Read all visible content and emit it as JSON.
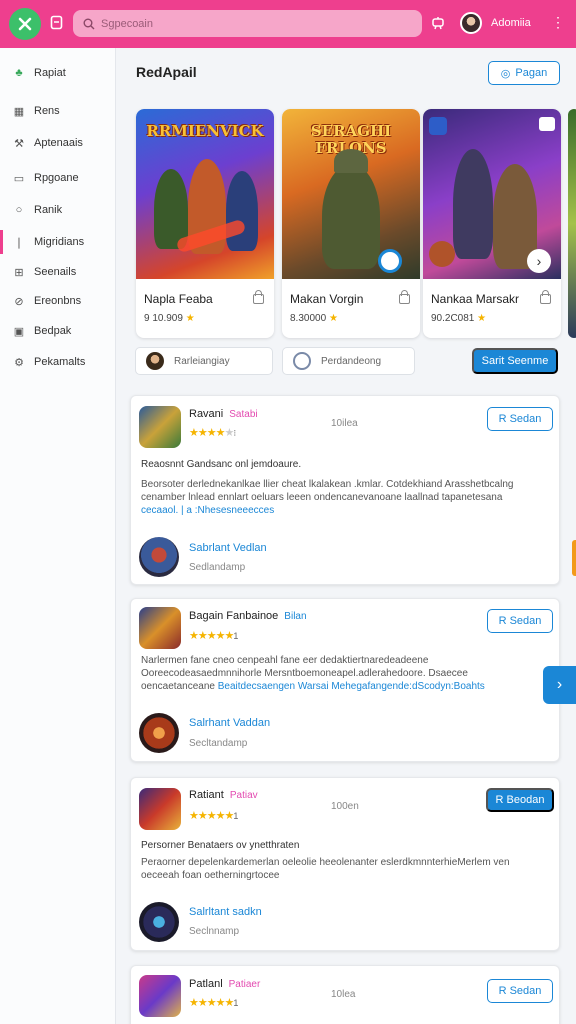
{
  "topbar": {
    "search_placeholder": "Sgpecoain",
    "username": "Adomiia",
    "icons": [
      "app-logo-icon",
      "bookmark-icon",
      "search-icon",
      "controller-icon",
      "kebab-menu-icon"
    ]
  },
  "colors": {
    "brand": "#ee3f8e",
    "accent": "#1b87d6",
    "logo": "#3cc06a",
    "star": "#f5b400"
  },
  "sidebar": {
    "items": [
      {
        "label": "Rapiat",
        "icon": "home-icon"
      },
      {
        "label": "Rens",
        "icon": "calendar-icon"
      },
      {
        "label": "Aptenaais",
        "icon": "wrench-icon"
      },
      {
        "label": "Rpgoane",
        "icon": "card-icon"
      },
      {
        "label": "Ranik",
        "icon": "circle-icon"
      },
      {
        "label": "Migridians",
        "icon": "marker-icon"
      },
      {
        "label": "Seenails",
        "icon": "grid-icon"
      },
      {
        "label": "Ereonbns",
        "icon": "globe-icon"
      },
      {
        "label": "Bedpak",
        "icon": "note-icon"
      },
      {
        "label": "Pekamalts",
        "icon": "settings-icon"
      }
    ]
  },
  "main": {
    "title": "RedApail",
    "header_button": "Pagan",
    "games": [
      {
        "art_title": "RRMIENVICK",
        "name": "Napla Feaba",
        "rating": "9 10.909"
      },
      {
        "art_title": "SERAGHI FRLONS",
        "name": "Makan Vorgin",
        "rating": "8.30000"
      },
      {
        "art_title": "",
        "name": "Nankaa Marsakr",
        "rating": "90.2C081"
      }
    ],
    "filters": [
      {
        "label": "Rarleiangiay"
      },
      {
        "label": "Perdandeong"
      }
    ],
    "filter_button": "Sarit Seenme",
    "reviews": [
      {
        "title": "Ravani",
        "tag": "Satabi",
        "stars": "★★★★",
        "rating_suffix": "⁝",
        "time": "10ilea",
        "button": "R Sedan",
        "headline": "Reaosnnt Gandsanc onl jemdoaure.",
        "body": "Beorsoter derlednekanlkae llier cheat lkalakean .kmlar. Cotdekhiand Arasshetbcalng cenamber lnlead ennlart oeluars leeen ondencanevanoane laallnad tapanetesana",
        "body_link": "cecaaol. | a :Nhesesneeecces",
        "author": "Sabrlant Vedlan",
        "author_sub": "Sedlandamp"
      },
      {
        "title": "Bagain Fanbainoe",
        "tag": "Bilan",
        "stars": "★★★★★",
        "rating_suffix": "1",
        "time": "",
        "button": "R Sedan",
        "headline": "",
        "body": "Narlermen fane cneo cenpeahl fane eer dedaktiertnaredeadeene Ooreecodeasaedmnnihorle Mersntboemoneapel.adlerahedoore. Dsaecee oencaetanceane",
        "body_link": "Beaitdecsaengen Warsai Mehegafangende:dScodyn:Boahts",
        "author": "Salrhant Vaddan",
        "author_sub": "Secltandamp"
      },
      {
        "title": "Ratiant",
        "tag": "Patiav",
        "stars": "★★★★★",
        "rating_suffix": "1",
        "time": "100en",
        "button": "R Beodan",
        "solid": true,
        "headline": "Persorner Benataers ov ynetthraten",
        "body": "Peraorner depelenkardemerlan oeleolie heeolenanter eslerdkmnnterhieMerlem ven oeceeah foan oetherningrtocee",
        "body_link": "",
        "author": "Salrltant sadkn",
        "author_sub": "Seclnnamp"
      },
      {
        "title": "Patlanl",
        "tag": "Patiaer",
        "stars": "★★★★★",
        "rating_suffix": "1",
        "time": "10lea",
        "button": "R Sedan"
      }
    ]
  }
}
